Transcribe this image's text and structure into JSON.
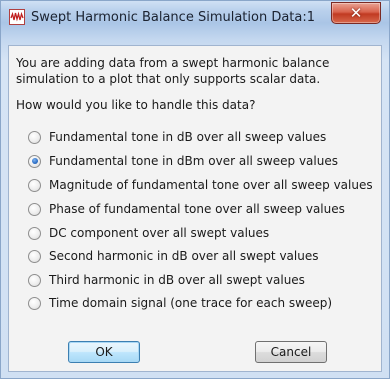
{
  "window": {
    "title": "Swept Harmonic Balance Simulation Data:1",
    "close_label": "✕"
  },
  "message": "You are adding data from a swept harmonic balance simulation to a plot that only supports scalar data.",
  "question": "How would you like to handle this data?",
  "options": [
    {
      "label": "Fundamental tone in dB over all sweep values",
      "selected": false
    },
    {
      "label": "Fundamental tone in dBm over all sweep values",
      "selected": true
    },
    {
      "label": "Magnitude of fundamental tone over all sweep values",
      "selected": false
    },
    {
      "label": "Phase of fundamental tone over all sweep values",
      "selected": false
    },
    {
      "label": "DC component over all swept values",
      "selected": false
    },
    {
      "label": "Second harmonic in dB over all swept values",
      "selected": false
    },
    {
      "label": "Third harmonic in dB over all swept values",
      "selected": false
    },
    {
      "label": "Time domain signal (one trace for each sweep)",
      "selected": false
    }
  ],
  "buttons": {
    "ok_label": "OK",
    "cancel_label": "Cancel"
  }
}
